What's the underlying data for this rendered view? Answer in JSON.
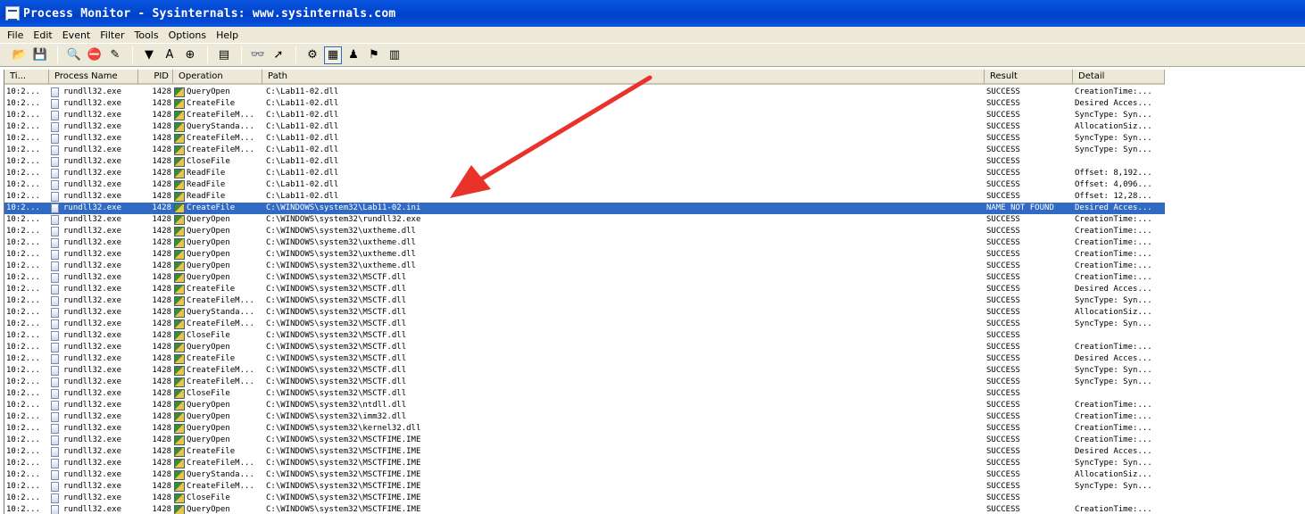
{
  "window": {
    "title": "Process Monitor - Sysinternals: www.sysinternals.com"
  },
  "menu": [
    "File",
    "Edit",
    "Event",
    "Filter",
    "Tools",
    "Options",
    "Help"
  ],
  "toolbar": {
    "buttons": [
      {
        "name": "open-icon",
        "glyph": "📂"
      },
      {
        "name": "save-icon",
        "glyph": "💾"
      },
      {
        "name": "sep"
      },
      {
        "name": "magnifier-icon",
        "glyph": "🔍"
      },
      {
        "name": "capture-toggle-icon",
        "glyph": "⛔"
      },
      {
        "name": "autoscroll-icon",
        "glyph": "✎"
      },
      {
        "name": "sep"
      },
      {
        "name": "filter-icon",
        "glyph": "▼"
      },
      {
        "name": "highlight-icon",
        "glyph": "A"
      },
      {
        "name": "target-icon",
        "glyph": "⊕"
      },
      {
        "name": "sep"
      },
      {
        "name": "process-tree-icon",
        "glyph": "▤"
      },
      {
        "name": "sep"
      },
      {
        "name": "find-icon",
        "glyph": "👓"
      },
      {
        "name": "jump-icon",
        "glyph": "➚"
      },
      {
        "name": "sep"
      },
      {
        "name": "registry-activity-icon",
        "glyph": "⚙"
      },
      {
        "name": "file-activity-icon",
        "glyph": "▦",
        "pressed": true
      },
      {
        "name": "network-activity-icon",
        "glyph": "♟"
      },
      {
        "name": "process-activity-icon",
        "glyph": "⚑"
      },
      {
        "name": "profiling-icon",
        "glyph": "▥"
      }
    ]
  },
  "columns": {
    "time": "Ti...",
    "process": "Process Name",
    "pid": "PID",
    "operation": "Operation",
    "path": "Path",
    "result": "Result",
    "detail": "Detail"
  },
  "rows": [
    {
      "time": "10:2...",
      "process": "rundll32.exe",
      "pid": "1428",
      "op": "QueryOpen",
      "path": "C:\\Lab11-02.dll",
      "result": "SUCCESS",
      "detail": "CreationTime:..."
    },
    {
      "time": "10:2...",
      "process": "rundll32.exe",
      "pid": "1428",
      "op": "CreateFile",
      "path": "C:\\Lab11-02.dll",
      "result": "SUCCESS",
      "detail": "Desired Acces..."
    },
    {
      "time": "10:2...",
      "process": "rundll32.exe",
      "pid": "1428",
      "op": "CreateFileM...",
      "path": "C:\\Lab11-02.dll",
      "result": "SUCCESS",
      "detail": "SyncType: Syn..."
    },
    {
      "time": "10:2...",
      "process": "rundll32.exe",
      "pid": "1428",
      "op": "QueryStanda...",
      "path": "C:\\Lab11-02.dll",
      "result": "SUCCESS",
      "detail": "AllocationSiz..."
    },
    {
      "time": "10:2...",
      "process": "rundll32.exe",
      "pid": "1428",
      "op": "CreateFileM...",
      "path": "C:\\Lab11-02.dll",
      "result": "SUCCESS",
      "detail": "SyncType: Syn..."
    },
    {
      "time": "10:2...",
      "process": "rundll32.exe",
      "pid": "1428",
      "op": "CreateFileM...",
      "path": "C:\\Lab11-02.dll",
      "result": "SUCCESS",
      "detail": "SyncType: Syn..."
    },
    {
      "time": "10:2...",
      "process": "rundll32.exe",
      "pid": "1428",
      "op": "CloseFile",
      "path": "C:\\Lab11-02.dll",
      "result": "SUCCESS",
      "detail": ""
    },
    {
      "time": "10:2...",
      "process": "rundll32.exe",
      "pid": "1428",
      "op": "ReadFile",
      "path": "C:\\Lab11-02.dll",
      "result": "SUCCESS",
      "detail": "Offset: 8,192..."
    },
    {
      "time": "10:2...",
      "process": "rundll32.exe",
      "pid": "1428",
      "op": "ReadFile",
      "path": "C:\\Lab11-02.dll",
      "result": "SUCCESS",
      "detail": "Offset: 4,096..."
    },
    {
      "time": "10:2...",
      "process": "rundll32.exe",
      "pid": "1428",
      "op": "ReadFile",
      "path": "C:\\Lab11-02.dll",
      "result": "SUCCESS",
      "detail": "Offset: 12,28..."
    },
    {
      "time": "10:2...",
      "process": "rundll32.exe",
      "pid": "1428",
      "op": "CreateFile",
      "path": "C:\\WINDOWS\\system32\\Lab11-02.ini",
      "result": "NAME NOT FOUND",
      "detail": "Desired Acces...",
      "selected": true
    },
    {
      "time": "10:2...",
      "process": "rundll32.exe",
      "pid": "1428",
      "op": "QueryOpen",
      "path": "C:\\WINDOWS\\system32\\rundll32.exe",
      "result": "SUCCESS",
      "detail": "CreationTime:..."
    },
    {
      "time": "10:2...",
      "process": "rundll32.exe",
      "pid": "1428",
      "op": "QueryOpen",
      "path": "C:\\WINDOWS\\system32\\uxtheme.dll",
      "result": "SUCCESS",
      "detail": "CreationTime:..."
    },
    {
      "time": "10:2...",
      "process": "rundll32.exe",
      "pid": "1428",
      "op": "QueryOpen",
      "path": "C:\\WINDOWS\\system32\\uxtheme.dll",
      "result": "SUCCESS",
      "detail": "CreationTime:..."
    },
    {
      "time": "10:2...",
      "process": "rundll32.exe",
      "pid": "1428",
      "op": "QueryOpen",
      "path": "C:\\WINDOWS\\system32\\uxtheme.dll",
      "result": "SUCCESS",
      "detail": "CreationTime:..."
    },
    {
      "time": "10:2...",
      "process": "rundll32.exe",
      "pid": "1428",
      "op": "QueryOpen",
      "path": "C:\\WINDOWS\\system32\\uxtheme.dll",
      "result": "SUCCESS",
      "detail": "CreationTime:..."
    },
    {
      "time": "10:2...",
      "process": "rundll32.exe",
      "pid": "1428",
      "op": "QueryOpen",
      "path": "C:\\WINDOWS\\system32\\MSCTF.dll",
      "result": "SUCCESS",
      "detail": "CreationTime:..."
    },
    {
      "time": "10:2...",
      "process": "rundll32.exe",
      "pid": "1428",
      "op": "CreateFile",
      "path": "C:\\WINDOWS\\system32\\MSCTF.dll",
      "result": "SUCCESS",
      "detail": "Desired Acces..."
    },
    {
      "time": "10:2...",
      "process": "rundll32.exe",
      "pid": "1428",
      "op": "CreateFileM...",
      "path": "C:\\WINDOWS\\system32\\MSCTF.dll",
      "result": "SUCCESS",
      "detail": "SyncType: Syn..."
    },
    {
      "time": "10:2...",
      "process": "rundll32.exe",
      "pid": "1428",
      "op": "QueryStanda...",
      "path": "C:\\WINDOWS\\system32\\MSCTF.dll",
      "result": "SUCCESS",
      "detail": "AllocationSiz..."
    },
    {
      "time": "10:2...",
      "process": "rundll32.exe",
      "pid": "1428",
      "op": "CreateFileM...",
      "path": "C:\\WINDOWS\\system32\\MSCTF.dll",
      "result": "SUCCESS",
      "detail": "SyncType: Syn..."
    },
    {
      "time": "10:2...",
      "process": "rundll32.exe",
      "pid": "1428",
      "op": "CloseFile",
      "path": "C:\\WINDOWS\\system32\\MSCTF.dll",
      "result": "SUCCESS",
      "detail": ""
    },
    {
      "time": "10:2...",
      "process": "rundll32.exe",
      "pid": "1428",
      "op": "QueryOpen",
      "path": "C:\\WINDOWS\\system32\\MSCTF.dll",
      "result": "SUCCESS",
      "detail": "CreationTime:..."
    },
    {
      "time": "10:2...",
      "process": "rundll32.exe",
      "pid": "1428",
      "op": "CreateFile",
      "path": "C:\\WINDOWS\\system32\\MSCTF.dll",
      "result": "SUCCESS",
      "detail": "Desired Acces..."
    },
    {
      "time": "10:2...",
      "process": "rundll32.exe",
      "pid": "1428",
      "op": "CreateFileM...",
      "path": "C:\\WINDOWS\\system32\\MSCTF.dll",
      "result": "SUCCESS",
      "detail": "SyncType: Syn..."
    },
    {
      "time": "10:2...",
      "process": "rundll32.exe",
      "pid": "1428",
      "op": "CreateFileM...",
      "path": "C:\\WINDOWS\\system32\\MSCTF.dll",
      "result": "SUCCESS",
      "detail": "SyncType: Syn..."
    },
    {
      "time": "10:2...",
      "process": "rundll32.exe",
      "pid": "1428",
      "op": "CloseFile",
      "path": "C:\\WINDOWS\\system32\\MSCTF.dll",
      "result": "SUCCESS",
      "detail": ""
    },
    {
      "time": "10:2...",
      "process": "rundll32.exe",
      "pid": "1428",
      "op": "QueryOpen",
      "path": "C:\\WINDOWS\\system32\\ntdll.dll",
      "result": "SUCCESS",
      "detail": "CreationTime:..."
    },
    {
      "time": "10:2...",
      "process": "rundll32.exe",
      "pid": "1428",
      "op": "QueryOpen",
      "path": "C:\\WINDOWS\\system32\\imm32.dll",
      "result": "SUCCESS",
      "detail": "CreationTime:..."
    },
    {
      "time": "10:2...",
      "process": "rundll32.exe",
      "pid": "1428",
      "op": "QueryOpen",
      "path": "C:\\WINDOWS\\system32\\kernel32.dll",
      "result": "SUCCESS",
      "detail": "CreationTime:..."
    },
    {
      "time": "10:2...",
      "process": "rundll32.exe",
      "pid": "1428",
      "op": "QueryOpen",
      "path": "C:\\WINDOWS\\system32\\MSCTFIME.IME",
      "result": "SUCCESS",
      "detail": "CreationTime:..."
    },
    {
      "time": "10:2...",
      "process": "rundll32.exe",
      "pid": "1428",
      "op": "CreateFile",
      "path": "C:\\WINDOWS\\system32\\MSCTFIME.IME",
      "result": "SUCCESS",
      "detail": "Desired Acces..."
    },
    {
      "time": "10:2...",
      "process": "rundll32.exe",
      "pid": "1428",
      "op": "CreateFileM...",
      "path": "C:\\WINDOWS\\system32\\MSCTFIME.IME",
      "result": "SUCCESS",
      "detail": "SyncType: Syn..."
    },
    {
      "time": "10:2...",
      "process": "rundll32.exe",
      "pid": "1428",
      "op": "QueryStanda...",
      "path": "C:\\WINDOWS\\system32\\MSCTFIME.IME",
      "result": "SUCCESS",
      "detail": "AllocationSiz..."
    },
    {
      "time": "10:2...",
      "process": "rundll32.exe",
      "pid": "1428",
      "op": "CreateFileM...",
      "path": "C:\\WINDOWS\\system32\\MSCTFIME.IME",
      "result": "SUCCESS",
      "detail": "SyncType: Syn..."
    },
    {
      "time": "10:2...",
      "process": "rundll32.exe",
      "pid": "1428",
      "op": "CloseFile",
      "path": "C:\\WINDOWS\\system32\\MSCTFIME.IME",
      "result": "SUCCESS",
      "detail": ""
    },
    {
      "time": "10:2...",
      "process": "rundll32.exe",
      "pid": "1428",
      "op": "QueryOpen",
      "path": "C:\\WINDOWS\\system32\\MSCTFIME.IME",
      "result": "SUCCESS",
      "detail": "CreationTime:..."
    }
  ],
  "colors": {
    "selection": "#316ac5",
    "annotation_arrow": "#e8322a"
  }
}
